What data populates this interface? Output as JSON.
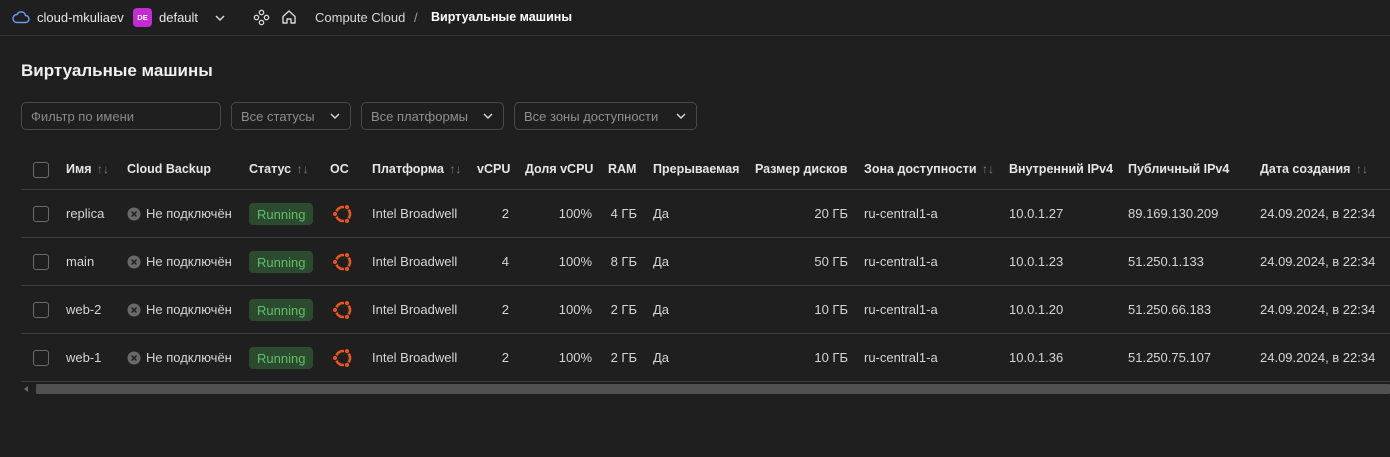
{
  "topbar": {
    "cloud_name": "cloud-mkuliaev",
    "folder_badge": "DE",
    "folder_name": "default",
    "breadcrumb_service": "Compute Cloud",
    "breadcrumb_sep": "/",
    "breadcrumb_current": "Виртуальные машины",
    "accent_color": "#c52bd4"
  },
  "page": {
    "title": "Виртуальные машины"
  },
  "filters": {
    "name_placeholder": "Фильтр по имени",
    "status": "Все статусы",
    "platform": "Все платформы",
    "zone": "Все зоны доступности"
  },
  "table": {
    "headers": {
      "name": "Имя",
      "backup": "Cloud Backup",
      "status": "Статус",
      "os": "ОС",
      "platform": "Платформа",
      "vcpu": "vCPU",
      "vcpu_share": "Доля vCPU",
      "ram": "RAM",
      "preemptible": "Прерываемая",
      "disk": "Размер дисков",
      "zone": "Зона доступности",
      "ipv4_int": "Внутренний IPv4",
      "ipv4_pub": "Публичный IPv4",
      "created": "Дата создания"
    },
    "sort_glyph": "↑↓",
    "rows": [
      {
        "name": "replica",
        "backup": "Не подключён",
        "status": "Running",
        "os_icon": "ubuntu-icon",
        "platform": "Intel Broadwell",
        "vcpu": "2",
        "vcpu_share": "100%",
        "ram": "4 ГБ",
        "preemptible": "Да",
        "disk": "20 ГБ",
        "zone": "ru-central1-a",
        "ipv4_int": "10.0.1.27",
        "ipv4_pub": "89.169.130.209",
        "created": "24.09.2024, в 22:34"
      },
      {
        "name": "main",
        "backup": "Не подключён",
        "status": "Running",
        "os_icon": "ubuntu-icon",
        "platform": "Intel Broadwell",
        "vcpu": "4",
        "vcpu_share": "100%",
        "ram": "8 ГБ",
        "preemptible": "Да",
        "disk": "50 ГБ",
        "zone": "ru-central1-a",
        "ipv4_int": "10.0.1.23",
        "ipv4_pub": "51.250.1.133",
        "created": "24.09.2024, в 22:34"
      },
      {
        "name": "web-2",
        "backup": "Не подключён",
        "status": "Running",
        "os_icon": "ubuntu-icon",
        "platform": "Intel Broadwell",
        "vcpu": "2",
        "vcpu_share": "100%",
        "ram": "2 ГБ",
        "preemptible": "Да",
        "disk": "10 ГБ",
        "zone": "ru-central1-a",
        "ipv4_int": "10.0.1.20",
        "ipv4_pub": "51.250.66.183",
        "created": "24.09.2024, в 22:34"
      },
      {
        "name": "web-1",
        "backup": "Не подключён",
        "status": "Running",
        "os_icon": "ubuntu-icon",
        "platform": "Intel Broadwell",
        "vcpu": "2",
        "vcpu_share": "100%",
        "ram": "2 ГБ",
        "preemptible": "Да",
        "disk": "10 ГБ",
        "zone": "ru-central1-a",
        "ipv4_int": "10.0.1.36",
        "ipv4_pub": "51.250.75.107",
        "created": "24.09.2024, в 22:34"
      }
    ]
  },
  "colors": {
    "running_bg": "#2c4a2f",
    "running_text": "#5fbf64",
    "ubuntu_orange": "#e95420"
  }
}
